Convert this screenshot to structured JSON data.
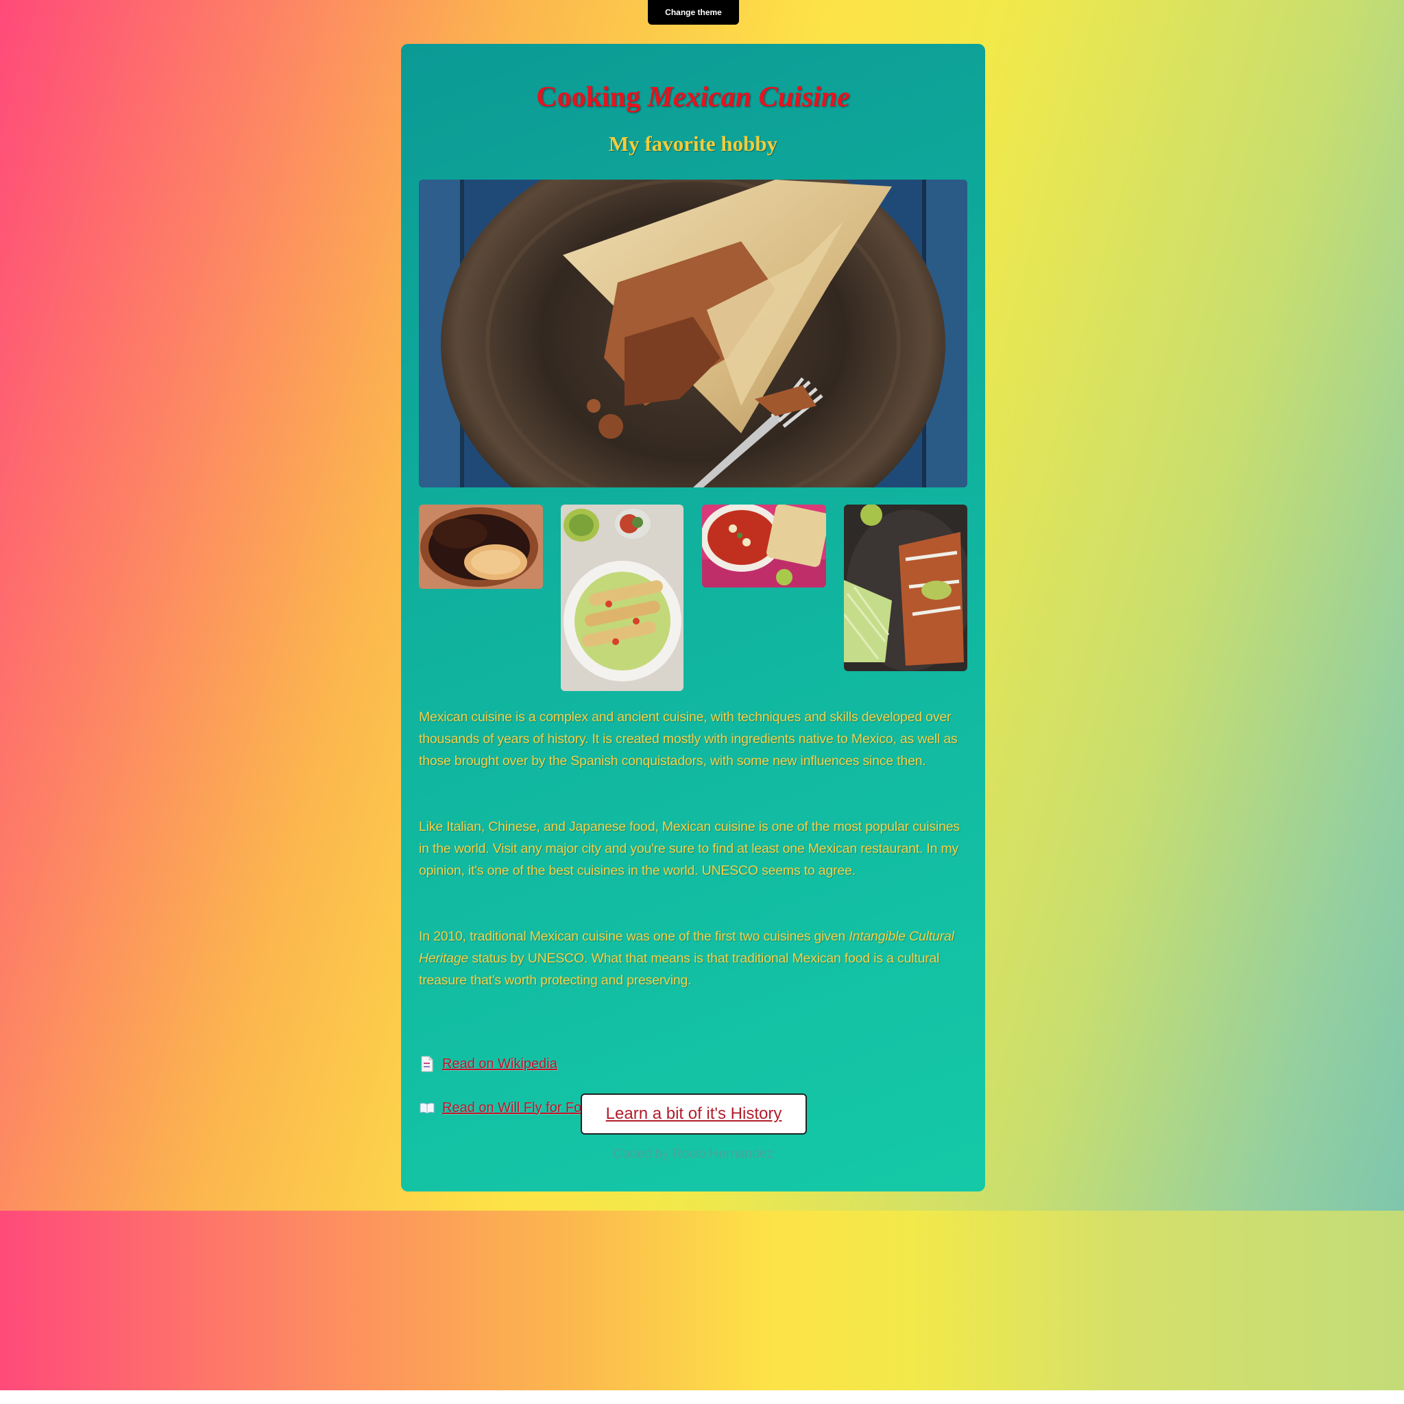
{
  "theme_button": {
    "label": "Change theme"
  },
  "header": {
    "title_plain": "Cooking",
    "title_italic": "Mexican Cuisine",
    "subtitle": "My favorite hobby"
  },
  "images": {
    "hero": "tamale-photo",
    "thumbnails": [
      "mole-and-rice-photo",
      "flautas-plate-photo",
      "pozole-tostadas-photo",
      "enchiladas-photo"
    ]
  },
  "content": {
    "p1": "Mexican cuisine is a complex and ancient cuisine, with techniques and skills developed over thousands of years of history. It is created mostly with ingredients native to Mexico, as well as those brought over by the Spanish conquistadors, with some new influences since then.",
    "p2": "Like Italian, Chinese, and Japanese food, Mexican cuisine is one of the most popular cuisines in the world. Visit any major city and you're sure to find at least one Mexican restaurant. In my opinion, it's one of the best cuisines in the world. UNESCO seems to agree.",
    "p3_before": "In 2010, traditional Mexican cuisine was one of the first two cuisines given ",
    "p3_em": "Intangible Cultural Heritage",
    "p3_after": " status by UNESCO. What that means is that traditional Mexican food is a cultural treasure that's worth protecting and preserving."
  },
  "links": [
    {
      "icon": "document-icon",
      "label": "Read on Wikipedia"
    },
    {
      "icon": "open-book-icon",
      "label": "Read on Will Fly for Food Blog"
    }
  ],
  "history_button": {
    "label": "Learn a bit of it's History"
  },
  "footer": {
    "credit": "Coded by Rocio Hernandez"
  },
  "colors": {
    "card": "#10b29e",
    "title": "#e8121e",
    "subtitle": "#f3cc3a",
    "body_text": "#f2d04a",
    "link": "#c8112a"
  }
}
